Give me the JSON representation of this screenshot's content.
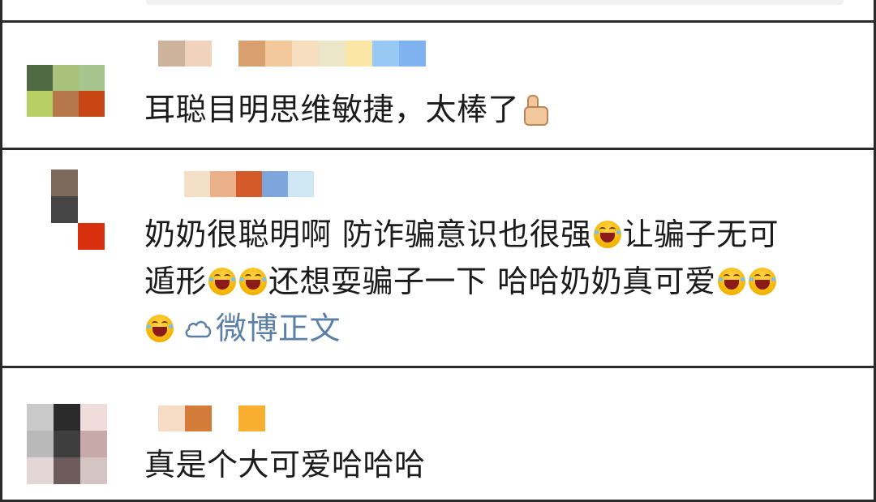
{
  "comments": [
    {
      "text_parts": [
        "耳聪目明思维敏捷，太棒了"
      ],
      "name_colors": [
        "#cdb39c",
        "#f1d2bd",
        "#ffffff",
        "#d8a06f",
        "#f3c99b",
        "#f6dfbe",
        "#ece6c8",
        "#fbe6a6",
        "#98c9f5",
        "#7fb3ef"
      ],
      "avatar_colors": [
        "#4f6b43",
        "#a9c27b",
        "#a6c58e",
        "#b8cf66",
        "#b6784a",
        "#c84614"
      ]
    },
    {
      "line1": "奶奶很聪明啊 防诈骗意识也很强",
      "line1_tail": "让骗子无可",
      "line2_a": "遁形",
      "line2_b": "还想耍骗子一下 哈哈奶奶真可爱",
      "link_label": "微博正文",
      "name_colors": [
        "#f4e0c7",
        "#e9b089",
        "#d55a2a",
        "#7da6dd",
        "#cfe7f2"
      ],
      "avatar_colors": [
        "#7d6a5a",
        "#ffffff",
        "#454545",
        "#ffffff",
        "#ffffff",
        "#d8300f"
      ]
    },
    {
      "text_parts": [
        "真是个大可爱哈哈哈"
      ],
      "name_colors": [
        "#f6dcc4",
        "#d37c3a",
        "#ffffff",
        "#f8ae2e"
      ],
      "avatar_colors": [
        "#c9c9c9",
        "#2b2b2b",
        "#f1dcdc",
        "#b9b9b9",
        "#3e3e3e",
        "#c7a9a9",
        "#e3d6d6",
        "#6e5c5c",
        "#d4c4c4"
      ]
    }
  ]
}
